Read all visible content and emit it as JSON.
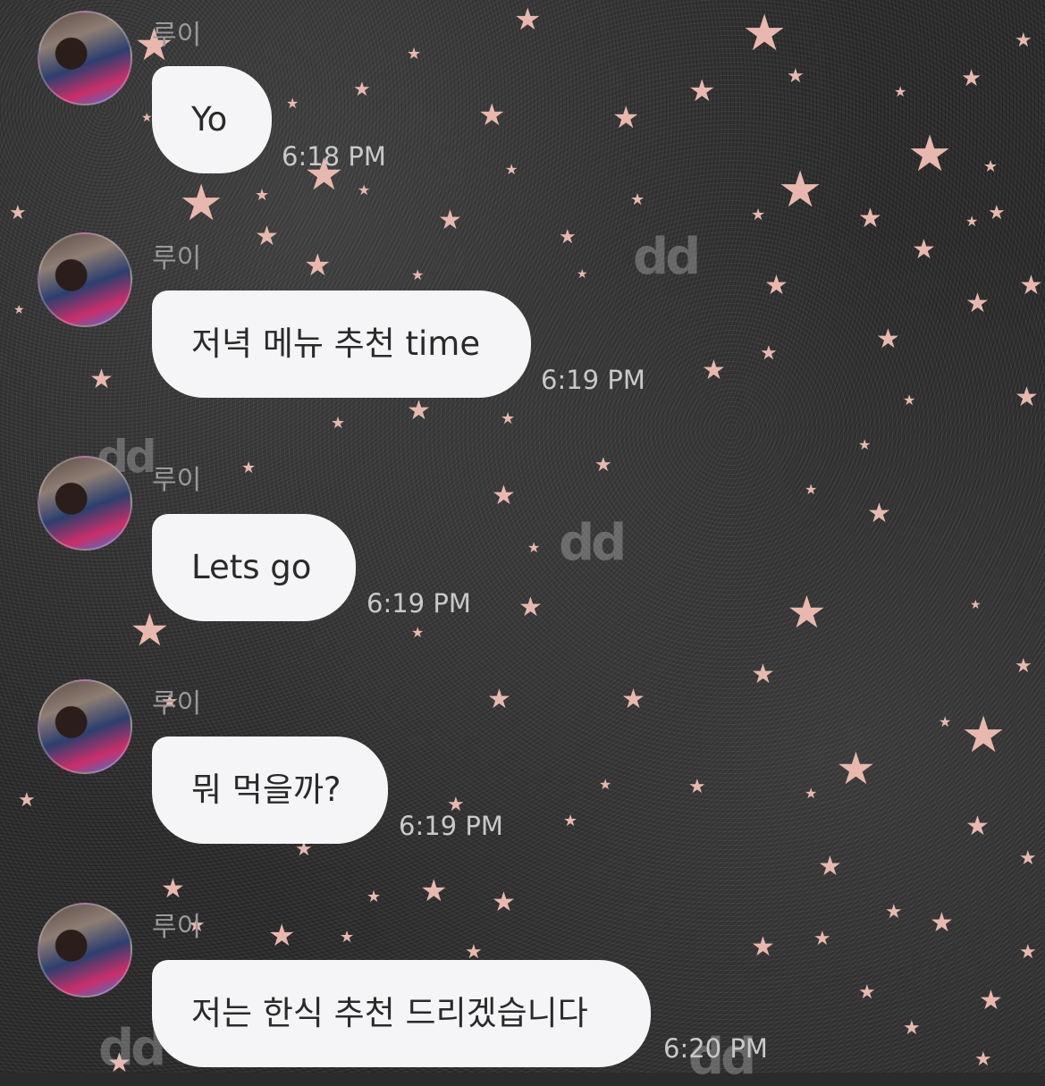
{
  "chat": {
    "messages": [
      {
        "sender": "루이",
        "text": "Yo",
        "time": "6:18 PM"
      },
      {
        "sender": "루이",
        "text": "저녁 메뉴 추천 time",
        "time": "6:19 PM"
      },
      {
        "sender": "루이",
        "text": "Lets go",
        "time": "6:19 PM"
      },
      {
        "sender": "루이",
        "text": "뭐 먹을까?",
        "time": "6:19 PM"
      },
      {
        "sender": "루이",
        "text": "저는 한식 추천 드리겠습니다",
        "time": "6:20 PM"
      }
    ],
    "watermark": "dd"
  },
  "colors": {
    "bubble": "#f5f5f7",
    "star": "#e8b8ae",
    "timestamp": "#c9c9c9",
    "sender": "#9a9a9a"
  },
  "icons": {
    "avatar": "profile-photo"
  }
}
